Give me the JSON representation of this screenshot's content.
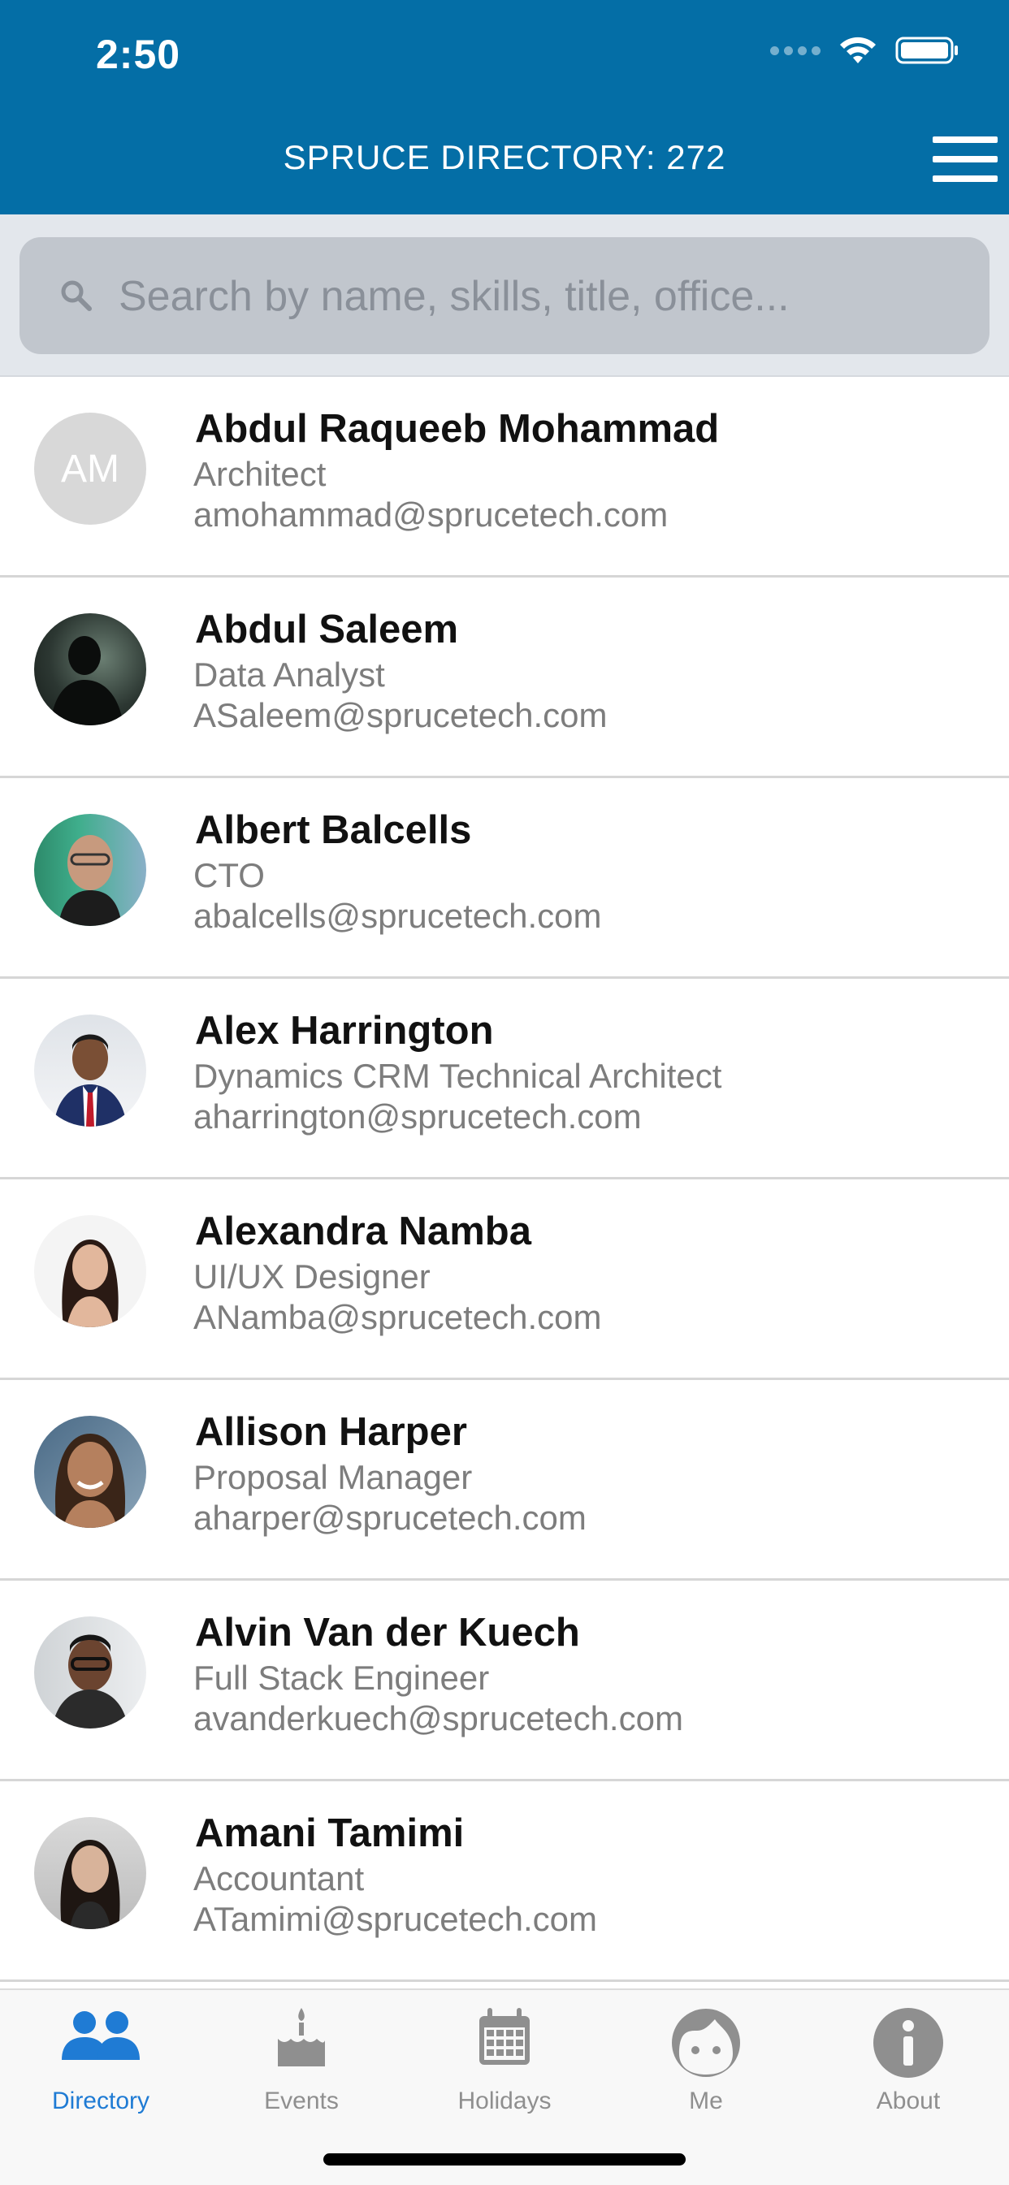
{
  "status": {
    "time": "2:50"
  },
  "header": {
    "title": "SPRUCE DIRECTORY: 272"
  },
  "search": {
    "placeholder": "Search by name, skills, title, office..."
  },
  "people": [
    {
      "initials": "AM",
      "name": "Abdul Raqueeb Mohammad",
      "title": "Architect",
      "email": "amohammad@sprucetech.com"
    },
    {
      "name": "Abdul Saleem",
      "title": "Data Analyst",
      "email": "ASaleem@sprucetech.com"
    },
    {
      "name": "Albert Balcells",
      "title": "CTO",
      "email": "abalcells@sprucetech.com"
    },
    {
      "name": "Alex Harrington",
      "title": "Dynamics CRM Technical Architect",
      "email": "aharrington@sprucetech.com"
    },
    {
      "name": "Alexandra Namba",
      "title": "UI/UX Designer",
      "email": "ANamba@sprucetech.com"
    },
    {
      "name": "Allison Harper",
      "title": "Proposal Manager",
      "email": "aharper@sprucetech.com"
    },
    {
      "name": "Alvin Van der Kuech",
      "title": "Full Stack Engineer",
      "email": "avanderkuech@sprucetech.com"
    },
    {
      "name": "Amani Tamimi",
      "title": "Accountant",
      "email": "ATamimi@sprucetech.com"
    }
  ],
  "tabs": [
    {
      "label": "Directory",
      "icon": "people-icon"
    },
    {
      "label": "Events",
      "icon": "cake-icon"
    },
    {
      "label": "Holidays",
      "icon": "calendar-icon"
    },
    {
      "label": "Me",
      "icon": "face-icon"
    },
    {
      "label": "About",
      "icon": "info-icon"
    }
  ],
  "colors": {
    "header": "#046ea6",
    "accent": "#1f7bd4",
    "inactive": "#8f8f8f"
  }
}
